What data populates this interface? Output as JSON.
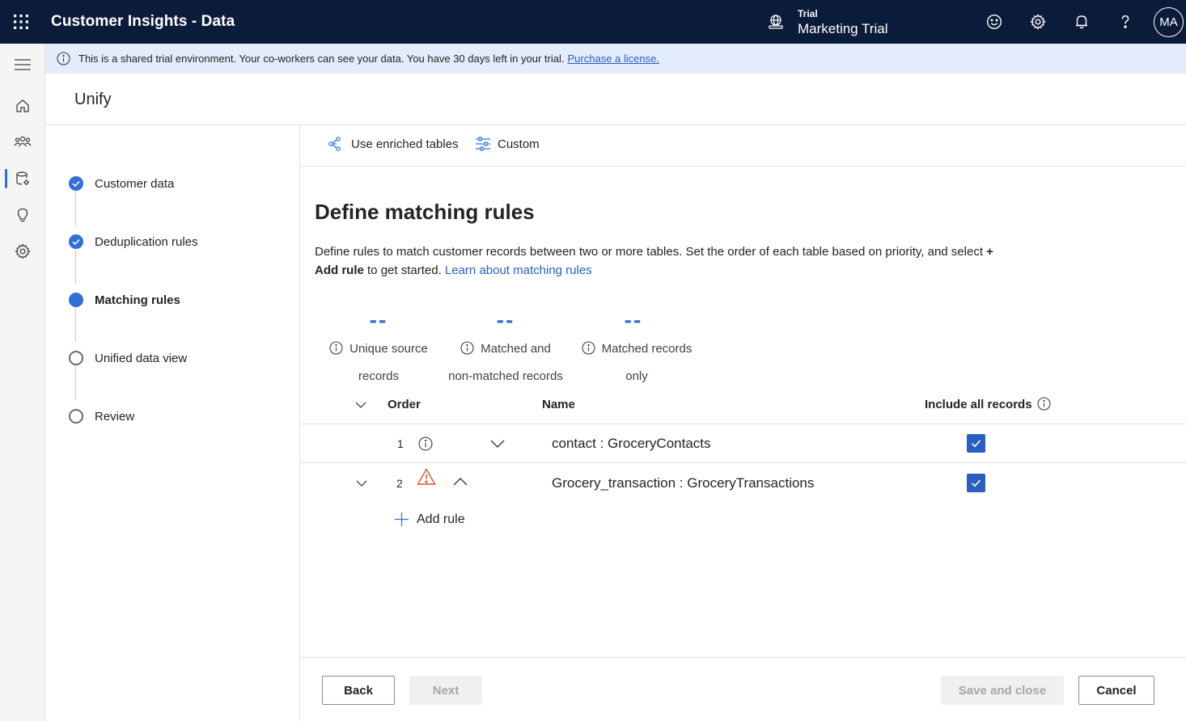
{
  "header": {
    "app_title": "Customer Insights - Data",
    "env_label": "Trial",
    "env_name": "Marketing Trial",
    "avatar_initials": "MA"
  },
  "banner": {
    "text": "This is a shared trial environment. Your co-workers can see your data. You have 30 days left in your trial.",
    "link": "Purchase a license."
  },
  "page": {
    "title": "Unify"
  },
  "steps": [
    {
      "label": "Customer data",
      "state": "done"
    },
    {
      "label": "Deduplication rules",
      "state": "done"
    },
    {
      "label": "Matching rules",
      "state": "current"
    },
    {
      "label": "Unified data view",
      "state": "todo"
    },
    {
      "label": "Review",
      "state": "todo"
    }
  ],
  "toolbar": {
    "enriched_label": "Use enriched tables",
    "custom_label": "Custom"
  },
  "main": {
    "title": "Define matching rules",
    "desc_part1": "Define rules to match customer records between two or more tables. Set the order of each table based on priority, and select ",
    "desc_bold": "+ Add rule",
    "desc_part2": " to get started. ",
    "desc_link": "Learn about matching rules"
  },
  "stats": [
    {
      "value": "--",
      "line1": "Unique source",
      "line2": "records"
    },
    {
      "value": "--",
      "line1": "Matched and",
      "line2": "non-matched records"
    },
    {
      "value": "--",
      "line1": "Matched records",
      "line2": "only"
    }
  ],
  "table": {
    "col_order": "Order",
    "col_name": "Name",
    "col_include": "Include all records",
    "rows": [
      {
        "order": "1",
        "name": "contact : GroceryContacts",
        "include_all": true
      },
      {
        "order": "2",
        "name": "Grocery_transaction : GroceryTransactions",
        "include_all": true
      }
    ],
    "add_rule_label": "Add rule"
  },
  "footer": {
    "back": "Back",
    "next": "Next",
    "save_close": "Save and close",
    "cancel": "Cancel"
  },
  "colors": {
    "topbar": "#0b1b3a",
    "accent": "#2f6fd9",
    "banner": "#e3ecfa",
    "warning": "#d9532c"
  },
  "icons": [
    "waffle-icon",
    "globe-icon",
    "smiley-icon",
    "gear-icon",
    "bell-icon",
    "help-icon",
    "menu-icon",
    "home-icon",
    "people-icon",
    "data-icon",
    "lightbulb-icon",
    "settings-icon",
    "info-icon",
    "warning-icon",
    "checkmark-icon",
    "plus-icon",
    "chevron-down-icon",
    "chevron-up-icon"
  ]
}
